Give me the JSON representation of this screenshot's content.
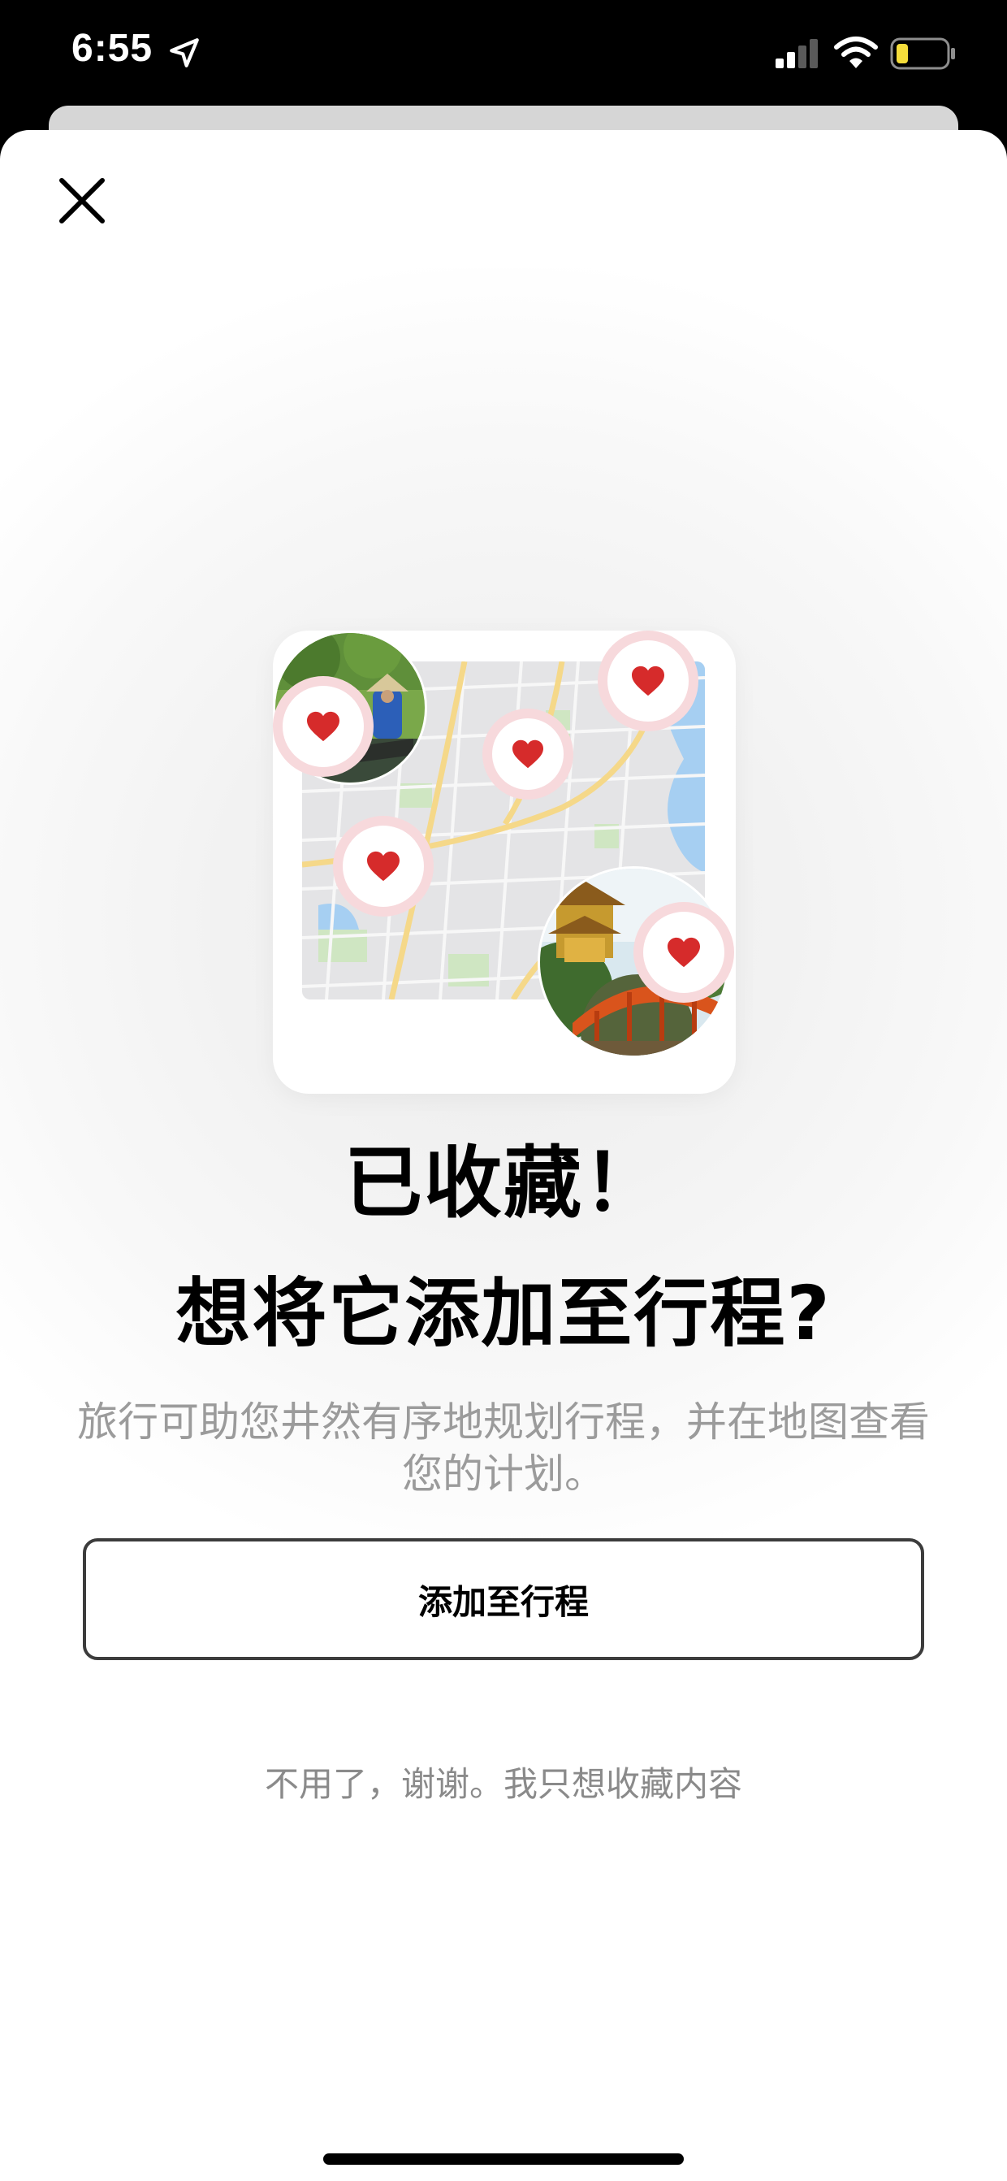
{
  "status_bar": {
    "time": "6:55",
    "icons": [
      "location-arrow-icon",
      "cellular-signal-icon",
      "wifi-icon",
      "battery-low-icon"
    ]
  },
  "close_icon": "close-icon",
  "illustration": {
    "elements": [
      "map-thumbnail",
      "photo-rice-field",
      "photo-temple-bridge",
      "heart-pin-icon"
    ]
  },
  "heading": {
    "title": "已收藏！",
    "subtitle": "想将它添加至行程?"
  },
  "description": "旅行可助您井然有序地规划行程，并在地图查看您的计划。",
  "buttons": {
    "primary": "添加至行程",
    "secondary": "不用了，谢谢。我只想收藏内容"
  },
  "colors": {
    "heart": "#d62b2b",
    "pin_ring": "#f7d9dc",
    "button_border": "#3c3c3c",
    "muted_text": "#9b9b9b"
  }
}
